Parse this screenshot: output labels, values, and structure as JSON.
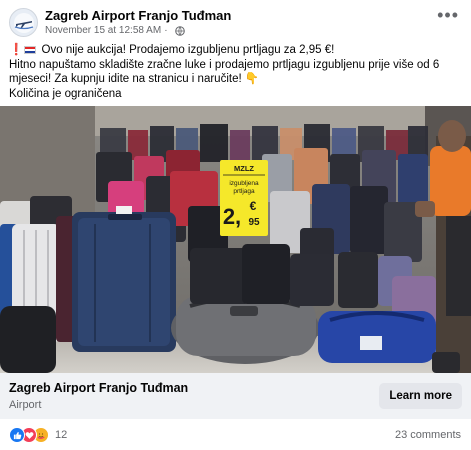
{
  "header": {
    "page_name": "Zagreb Airport Franjo Tuđman",
    "timestamp": "November 15 at 12:58 AM",
    "separator": "·",
    "more_label": "•••"
  },
  "post": {
    "line1_text": "Ovo nije aukcija! Prodajemo izgubljenu prtljagu za 2,95 €!",
    "line2_text": "Hitno napuštamo skladište zračne luke i prodajemo prtljagu izgubljenu prije više od 6 mjeseci! Za kupnju idite na stranicu i naručite!",
    "line2_emoji": "👇",
    "line3_text": "Količina je ograničena"
  },
  "photo": {
    "sign_brand": "MZLZ",
    "sign_line1": "izgubljena",
    "sign_line2": "prtljaga",
    "sign_price_main": "2,",
    "sign_currency": "€",
    "sign_price_cents": "95",
    "sign_color": "#f5e82a"
  },
  "link_card": {
    "title": "Zagreb Airport Franjo Tuđman",
    "subtitle": "Airport",
    "button_label": "Learn more"
  },
  "footer": {
    "reaction_count": "12",
    "comments_label": "23 comments",
    "reaction_icons": [
      "like-icon",
      "love-icon",
      "care-icon"
    ]
  },
  "colors": {
    "facebook_blue": "#1877f2",
    "love_red": "#f33e58",
    "care_yellow": "#f7b125",
    "muted_text": "#65676b",
    "card_bg": "#f0f2f5"
  }
}
